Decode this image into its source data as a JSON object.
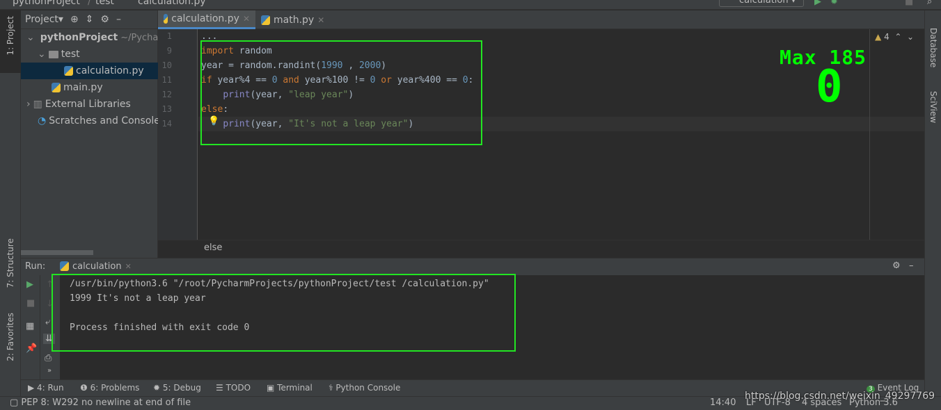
{
  "navbar": {
    "crumbs": [
      "pythonProject",
      "test",
      "calculation.py"
    ],
    "run_config": "calculation"
  },
  "left_strip": {
    "project": "1: Project",
    "structure": "7: Structure",
    "favorites": "2: Favorites"
  },
  "right_strip": {
    "database": "Database",
    "sciview": "SciView"
  },
  "project_panel": {
    "title": "Project",
    "tree": [
      {
        "label": "pythonProject",
        "hint": "~/PycharmProjects/pythonProject",
        "type": "folder"
      },
      {
        "label": "test",
        "type": "folder"
      },
      {
        "label": "calculation.py",
        "type": "py",
        "selected": true
      },
      {
        "label": "main.py",
        "type": "py"
      },
      {
        "label": "External Libraries",
        "type": "lib"
      },
      {
        "label": "Scratches and Consoles",
        "type": "scratch"
      }
    ]
  },
  "editor": {
    "tabs": [
      {
        "label": "calculation.py",
        "active": true
      },
      {
        "label": "math.py",
        "active": false
      }
    ],
    "warnings": "4",
    "lines": [
      {
        "n": "1",
        "tokens": [
          [
            "",
            "..."
          ]
        ]
      },
      {
        "n": "9",
        "tokens": [
          [
            "kw",
            "import"
          ],
          [
            "",
            " random"
          ]
        ]
      },
      {
        "n": "10",
        "tokens": [
          [
            "",
            "year = random.randint("
          ],
          [
            "num",
            "1990"
          ],
          [
            "",
            " , "
          ],
          [
            "num",
            "2000"
          ],
          [
            "",
            ")"
          ]
        ]
      },
      {
        "n": "11",
        "tokens": [
          [
            "kw",
            "if"
          ],
          [
            "",
            " year%4 == "
          ],
          [
            "num",
            "0"
          ],
          [
            "kw",
            " and"
          ],
          [
            "",
            " year%100 != "
          ],
          [
            "num",
            "0"
          ],
          [
            "kw",
            " or"
          ],
          [
            "",
            " year%400 == "
          ],
          [
            "num",
            "0"
          ],
          [
            "",
            ":"
          ]
        ]
      },
      {
        "n": "12",
        "tokens": [
          [
            "",
            "    "
          ],
          [
            "bi",
            "print"
          ],
          [
            "",
            "(year, "
          ],
          [
            "str",
            "\"leap year\""
          ],
          [
            "",
            ")"
          ]
        ]
      },
      {
        "n": "13",
        "tokens": [
          [
            "kw",
            "else"
          ],
          [
            "",
            ":"
          ]
        ]
      },
      {
        "n": "14",
        "tokens": [
          [
            "",
            "    "
          ],
          [
            "bi",
            "print"
          ],
          [
            "",
            "(year, "
          ],
          [
            "str",
            "\"It's not a leap year\""
          ],
          [
            "",
            ")"
          ]
        ]
      }
    ],
    "overlay": {
      "label": "Max 185",
      "value": "0"
    },
    "breadcrumb": "else"
  },
  "run": {
    "label": "Run:",
    "tab": "calculation",
    "output": [
      "/usr/bin/python3.6 \"/root/PycharmProjects/pythonProject/test /calculation.py\"",
      "1999 It's not a leap year",
      "",
      "Process finished with exit code 0"
    ]
  },
  "tool_tabs": [
    "4: Run",
    "6: Problems",
    "5: Debug",
    "TODO",
    "Terminal",
    "Python Console"
  ],
  "event_log": {
    "label": "Event Log",
    "count": "3"
  },
  "status": {
    "message": "PEP 8: W292 no newline at end of file",
    "position": "14:40",
    "line_sep": "LF",
    "encoding": "UTF-8",
    "indent": "4 spaces",
    "interpreter": "Python 3.6"
  },
  "watermark": "https://blog.csdn.net/weixin_49297769",
  "colors": {
    "highlight_box": "#22e622",
    "keyword": "#cc7832",
    "number": "#6897bb",
    "string": "#6a8759",
    "builtin": "#8888c6"
  }
}
